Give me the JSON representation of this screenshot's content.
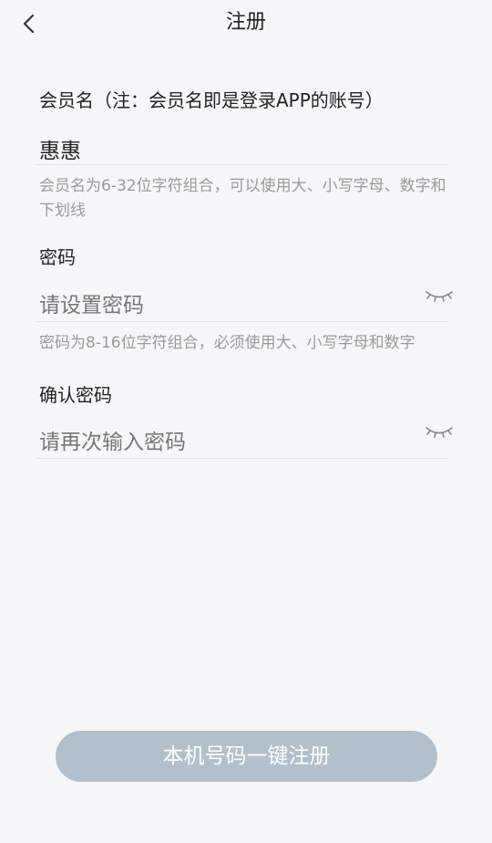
{
  "header": {
    "title": "注册"
  },
  "form": {
    "member": {
      "label": "会员名（注：会员名即是登录APP的账号）",
      "value": "惠惠",
      "hint": "会员名为6-32位字符组合，可以使用大、小写字母、数字和下划线"
    },
    "password": {
      "label": "密码",
      "placeholder": "请设置密码",
      "hint": "密码为8-16位字符组合，必须使用大、小写字母和数字"
    },
    "confirm": {
      "label": "确认密码",
      "placeholder": "请再次输入密码"
    }
  },
  "actions": {
    "register_label": "本机号码一键注册"
  },
  "icons": {
    "back": "chevron-left-icon",
    "eye": "eye-closed-icon"
  }
}
